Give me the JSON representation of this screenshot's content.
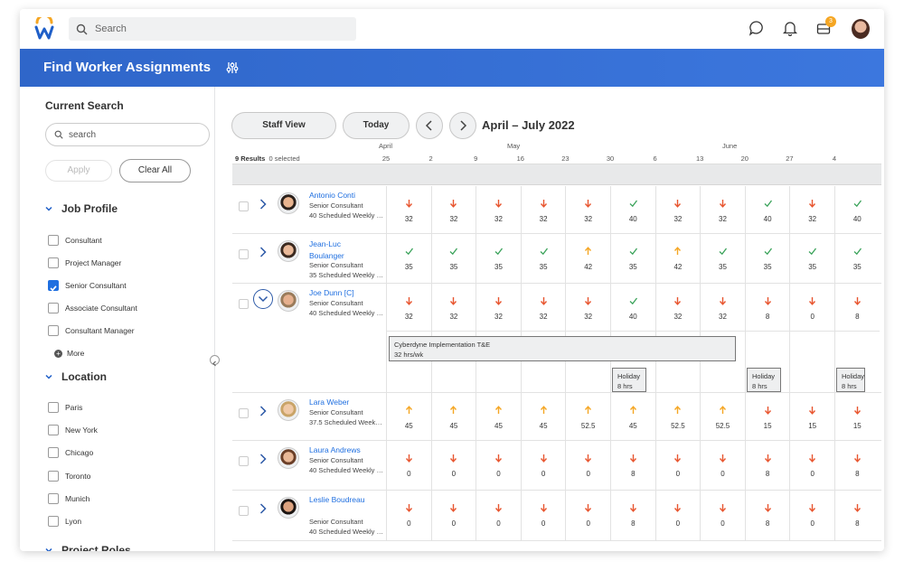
{
  "topbar": {
    "search_placeholder": "Search",
    "notification_count": "3",
    "icons": [
      "workday-logo-icon",
      "chat-icon",
      "bell-icon",
      "inbox-icon"
    ]
  },
  "header": {
    "title": "Find Worker Assignments"
  },
  "sidebar": {
    "title": "Current Search",
    "search_placeholder": "search",
    "apply_label": "Apply",
    "clear_label": "Clear All",
    "job_profile": {
      "title": "Job Profile",
      "options": [
        {
          "label": "Consultant",
          "checked": false
        },
        {
          "label": "Project Manager",
          "checked": false
        },
        {
          "label": "Senior Consultant",
          "checked": true
        },
        {
          "label": "Associate Consultant",
          "checked": false
        },
        {
          "label": "Consultant Manager",
          "checked": false
        }
      ],
      "more_label": "More"
    },
    "location": {
      "title": "Location",
      "options": [
        {
          "label": "Paris",
          "checked": false
        },
        {
          "label": "New York",
          "checked": false
        },
        {
          "label": "Chicago",
          "checked": false
        },
        {
          "label": "Toronto",
          "checked": false
        },
        {
          "label": "Munich",
          "checked": false
        },
        {
          "label": "Lyon",
          "checked": false
        }
      ]
    },
    "project_roles": {
      "title": "Project Roles"
    }
  },
  "toolbar": {
    "staff_view_label": "Staff View",
    "today_label": "Today",
    "range_title": "April – July 2022"
  },
  "timeline": {
    "months": [
      "April",
      "May",
      "June"
    ],
    "dates": [
      "25",
      "2",
      "9",
      "16",
      "23",
      "30",
      "6",
      "13",
      "20",
      "27",
      "4"
    ],
    "results_count": "9 Results",
    "selected_count": "0 selected"
  },
  "colors": {
    "under": "#e8552f",
    "ok": "#3aa35a",
    "over": "#f5a623",
    "link": "#1f6fe0",
    "header": "#3270d6"
  },
  "workers": [
    {
      "name": "Antonio Conti",
      "title": "Senior Consultant",
      "scheduled": "40 Scheduled Weekly Hours",
      "weeks": [
        [
          "down",
          "32"
        ],
        [
          "down",
          "32"
        ],
        [
          "down",
          "32"
        ],
        [
          "down",
          "32"
        ],
        [
          "down",
          "32"
        ],
        [
          "check",
          "40"
        ],
        [
          "down",
          "32"
        ],
        [
          "down",
          "32"
        ],
        [
          "check",
          "40"
        ],
        [
          "down",
          "32"
        ],
        [
          "check",
          "40"
        ]
      ]
    },
    {
      "name": "Jean-Luc Boulanger",
      "title": "Senior Consultant",
      "scheduled": "35 Scheduled Weekly Hours",
      "weeks": [
        [
          "check",
          "35"
        ],
        [
          "check",
          "35"
        ],
        [
          "check",
          "35"
        ],
        [
          "check",
          "35"
        ],
        [
          "up",
          "42"
        ],
        [
          "check",
          "35"
        ],
        [
          "up",
          "42"
        ],
        [
          "check",
          "35"
        ],
        [
          "check",
          "35"
        ],
        [
          "check",
          "35"
        ],
        [
          "check",
          "35"
        ]
      ]
    },
    {
      "name": "Joe Dunn [C]",
      "title": "Senior Consultant",
      "scheduled": "40 Scheduled Weekly Hours",
      "weeks": [
        [
          "down",
          "32"
        ],
        [
          "down",
          "32"
        ],
        [
          "down",
          "32"
        ],
        [
          "down",
          "32"
        ],
        [
          "down",
          "32"
        ],
        [
          "check",
          "40"
        ],
        [
          "down",
          "32"
        ],
        [
          "down",
          "32"
        ],
        [
          "down",
          "8"
        ],
        [
          "down",
          "0"
        ],
        [
          "down",
          "8"
        ]
      ],
      "assignment": {
        "name": "Cyberdyne Implementation T&E",
        "hours": "32 hrs/wk"
      },
      "holidays": [
        {
          "label": "Holiday",
          "hours": "8 hrs"
        },
        {
          "label": "Holiday",
          "hours": "8 hrs"
        },
        {
          "label": "Holiday",
          "hours": "8 hrs"
        }
      ]
    },
    {
      "name": "Lara Weber",
      "title": "Senior Consultant",
      "scheduled": "37.5 Scheduled Weekly Hours",
      "weeks": [
        [
          "up",
          "45"
        ],
        [
          "up",
          "45"
        ],
        [
          "up",
          "45"
        ],
        [
          "up",
          "45"
        ],
        [
          "up",
          "52.5"
        ],
        [
          "up",
          "45"
        ],
        [
          "up",
          "52.5"
        ],
        [
          "up",
          "52.5"
        ],
        [
          "down",
          "15"
        ],
        [
          "down",
          "15"
        ],
        [
          "down",
          "15"
        ]
      ]
    },
    {
      "name": "Laura Andrews",
      "title": "Senior Consultant",
      "scheduled": "40 Scheduled Weekly Hours",
      "weeks": [
        [
          "down",
          "0"
        ],
        [
          "down",
          "0"
        ],
        [
          "down",
          "0"
        ],
        [
          "down",
          "0"
        ],
        [
          "down",
          "0"
        ],
        [
          "down",
          "8"
        ],
        [
          "down",
          "0"
        ],
        [
          "down",
          "0"
        ],
        [
          "down",
          "8"
        ],
        [
          "down",
          "0"
        ],
        [
          "down",
          "8"
        ]
      ]
    },
    {
      "name": "Leslie Boudreau",
      "title": "Senior Consultant",
      "scheduled": "40 Scheduled Weekly Hours",
      "weeks": [
        [
          "down",
          "0"
        ],
        [
          "down",
          "0"
        ],
        [
          "down",
          "0"
        ],
        [
          "down",
          "0"
        ],
        [
          "down",
          "0"
        ],
        [
          "down",
          "8"
        ],
        [
          "down",
          "0"
        ],
        [
          "down",
          "0"
        ],
        [
          "down",
          "8"
        ],
        [
          "down",
          "0"
        ],
        [
          "down",
          "8"
        ]
      ]
    }
  ]
}
